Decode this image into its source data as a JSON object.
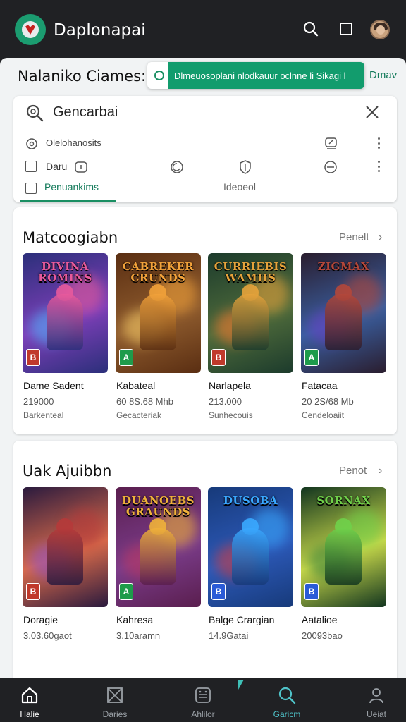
{
  "appbar": {
    "title": "Daplonapai",
    "icons": [
      "search-icon",
      "window-icon",
      "avatar"
    ]
  },
  "header": {
    "title": "Nalaniko Ciames:",
    "banner_text": "Dlmeuosoplani nlodkauur oclnne li Sikagi l",
    "banner_link": "Dmav"
  },
  "search": {
    "value": "Gencarbai"
  },
  "filters": {
    "row1_label": "Olelohanosits",
    "row2_label": "Daru",
    "tab_active": "Penuankims",
    "tab_inactive": "Ideoeol"
  },
  "sections": [
    {
      "title": "Matcoogiabn",
      "link": "Penelt",
      "games": [
        {
          "name": "Dame Sadent",
          "meta1": "219000",
          "meta2": "Barkenteal",
          "logo": "DIVINA ROMINS",
          "badge": "B",
          "colors": [
            "#2b2f7a",
            "#e85a9c",
            "#4db8ff",
            "#7d3fb8"
          ]
        },
        {
          "name": "Kabateal",
          "meta1": "60 8S.68 Mhb",
          "meta2": "Gecacteriak",
          "logo": "CABREKER CRUNDS",
          "badge": "A",
          "colors": [
            "#5a2e12",
            "#f2a23a",
            "#ffd36b",
            "#8f5c2e"
          ]
        },
        {
          "name": "Narlapela",
          "meta1": "213.000",
          "meta2": "Sunhecouis",
          "logo": "CURRIEBIS WAMIIS",
          "badge": "B",
          "colors": [
            "#1c3b2c",
            "#e6a33b",
            "#ff7a2e",
            "#4f6b3b"
          ]
        },
        {
          "name": "Fatacaa",
          "meta1": "20 2S/68 Mb",
          "meta2": "Cendeloaiit",
          "logo": "ZIGMAX",
          "badge": "A",
          "colors": [
            "#2a1d2e",
            "#b4473a",
            "#6b3fc8",
            "#3a5fa0"
          ]
        }
      ]
    },
    {
      "title": "Uak Ajuibbn",
      "link": "Penot",
      "games": [
        {
          "name": "Doragie",
          "meta1": "3.03.60gaot",
          "meta2": "",
          "logo": "",
          "badge": "B",
          "colors": [
            "#2a1a3e",
            "#b53a3a",
            "#8a4fd0",
            "#d86a4a"
          ]
        },
        {
          "name": "Kahresa",
          "meta1": "3.10aramn",
          "meta2": "",
          "logo": "DUANOEBS GRAUNDS",
          "badge": "A",
          "colors": [
            "#5a1e4e",
            "#f0b13a",
            "#c2385f",
            "#7a3c8a"
          ]
        },
        {
          "name": "Balge Crargian",
          "meta1": "14.9Gatai",
          "meta2": "",
          "logo": "DUSOBA",
          "badge": "B",
          "colors": [
            "#173a7a",
            "#3aa8ff",
            "#d93a3a",
            "#2c59b8"
          ]
        },
        {
          "name": "Aatalioe",
          "meta1": "20093bao",
          "meta2": "",
          "logo": "SORNAX",
          "badge": "B",
          "colors": [
            "#12351f",
            "#6fd04a",
            "#2e7a3a",
            "#c8d84a"
          ]
        }
      ]
    }
  ],
  "bottomnav": [
    {
      "label": "Halie",
      "icon": "home-icon",
      "state": "home"
    },
    {
      "label": "Daries",
      "icon": "box-x-icon",
      "state": ""
    },
    {
      "label": "Ahlilor",
      "icon": "controller-icon",
      "state": ""
    },
    {
      "label": "Garicm",
      "icon": "search-icon",
      "state": "active"
    },
    {
      "label": "Ueiat",
      "icon": "person-icon",
      "state": ""
    }
  ]
}
